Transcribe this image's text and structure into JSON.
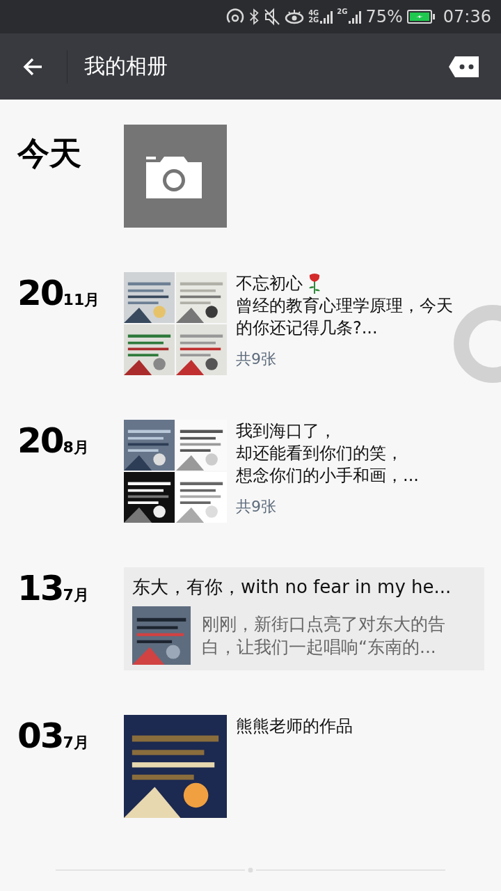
{
  "status_bar": {
    "network_labels": [
      "4G",
      "2G",
      "2G"
    ],
    "battery": "75%",
    "time": "07:36"
  },
  "title_bar": {
    "title": "我的相册"
  },
  "posts": [
    {
      "kind": "camera",
      "date": {
        "day": "今天"
      }
    },
    {
      "kind": "images",
      "date": {
        "day": "20",
        "month": "11月"
      },
      "lines": [
        "不忘初心",
        "曾经的教育心理学原理，今天的你还记得几条?..."
      ],
      "title_emoji": true,
      "count": "共9张",
      "images": [
        {
          "kind": "picture"
        },
        {
          "kind": "picture"
        },
        {
          "kind": "picture"
        },
        {
          "kind": "picture"
        }
      ]
    },
    {
      "kind": "images",
      "date": {
        "day": "20",
        "month": "8月"
      },
      "lines": [
        "我到海口了，",
        "却还能看到你们的笑，",
        "想念你们的小手和画，..."
      ],
      "count": "共9张",
      "images": [
        {
          "kind": "picture"
        },
        {
          "kind": "picture"
        },
        {
          "kind": "picture"
        },
        {
          "kind": "picture"
        }
      ]
    },
    {
      "kind": "link",
      "date": {
        "day": "13",
        "month": "7月"
      },
      "title": "东大，有你，with no fear in my he...",
      "summary": "刚刚，新街口点亮了对东大的告白，让我们一起唱响“东南的...",
      "images": [
        {
          "kind": "picture"
        }
      ]
    },
    {
      "kind": "images",
      "date": {
        "day": "03",
        "month": "7月"
      },
      "lines": [
        "熊熊老师的作品"
      ],
      "images": [
        {
          "kind": "picture"
        }
      ]
    }
  ]
}
